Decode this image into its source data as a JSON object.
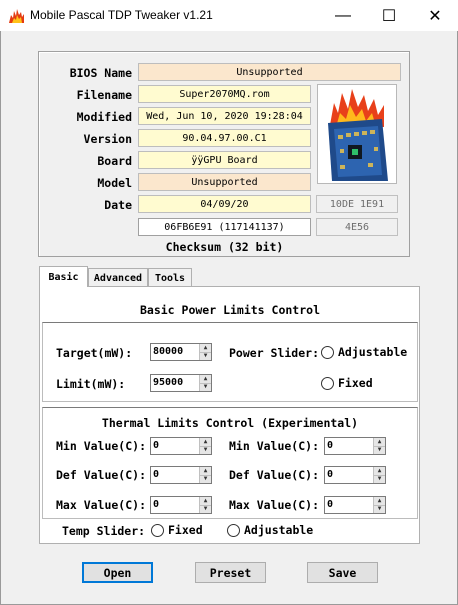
{
  "window": {
    "title": "Mobile Pascal TDP Tweaker v1.21",
    "minimize_glyph": "—",
    "maximize_glyph": "☐",
    "close_glyph": "✕",
    "app_icon": "fire-icon"
  },
  "info": {
    "bios_name_label": "BIOS Name",
    "bios_name_value": "Unsupported",
    "filename_label": "Filename",
    "filename_value": "Super2070MQ.rom",
    "modified_label": "Modified",
    "modified_value": "Wed, Jun 10, 2020 19:28:04",
    "version_label": "Version",
    "version_value": "90.04.97.00.C1",
    "board_label": "Board",
    "board_value": "ÿÿGPU Board",
    "model_label": "Model",
    "model_value": "Unsupported",
    "date_label": "Date",
    "date_value": "04/09/20",
    "device_id": "10DE 1E91",
    "checksum_value": "06FB6E91 (117141137)",
    "checksum_short": "4E56",
    "checksum_caption": "Checksum (32 bit)",
    "gpu_image_icon": "burning-gpu-board-icon"
  },
  "tabs": [
    "Basic",
    "Advanced",
    "Tools"
  ],
  "active_tab": "Basic",
  "basic": {
    "power_title": "Basic Power Limits Control",
    "target_label": "Target(mW):",
    "target_value": "80000",
    "limit_label": "Limit(mW):",
    "limit_value": "95000",
    "power_slider_label": "Power Slider:",
    "adjustable_label": "Adjustable",
    "fixed_label": "Fixed"
  },
  "thermal": {
    "title": "Thermal Limits Control (Experimental)",
    "min_label": "Min Value(C):",
    "def_label": "Def Value(C):",
    "max_label": "Max Value(C):",
    "min_left": "0",
    "min_right": "0",
    "def_left": "0",
    "def_right": "0",
    "max_left": "0",
    "max_right": "0",
    "temp_slider_label": "Temp Slider:",
    "fixed_label": "Fixed",
    "adjustable_label": "Adjustable"
  },
  "buttons": {
    "open": "Open",
    "preset": "Preset",
    "save": "Save"
  },
  "colors": {
    "readonly_yellow": "#fffbd0",
    "unsupported_peach": "#fbe7cd",
    "focus_blue": "#0078d7"
  }
}
